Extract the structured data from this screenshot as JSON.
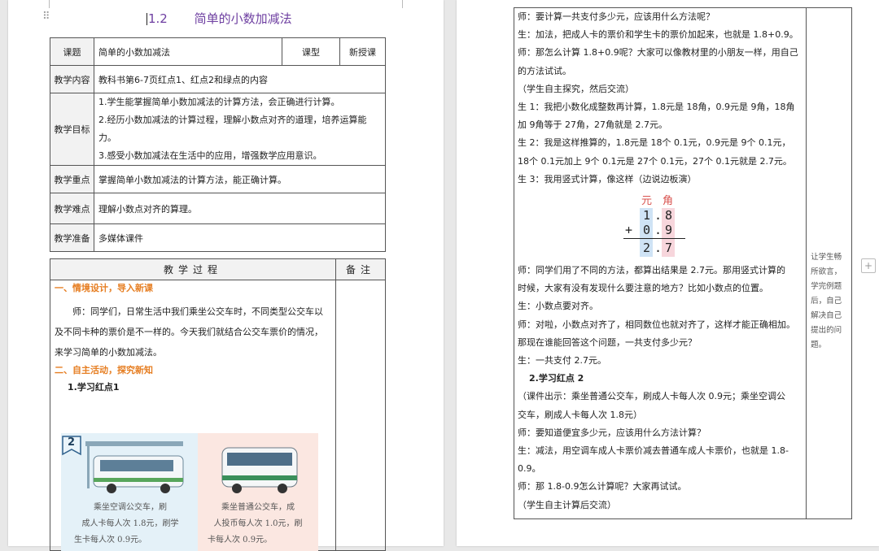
{
  "left": {
    "title_prefix": "1.2",
    "title_text": "简单的小数加减法",
    "info": {
      "r1": {
        "label": "课题",
        "value": "简单的小数加减法",
        "type_label": "课型",
        "type_value": "新授课"
      },
      "r2": {
        "label": "教学内容",
        "value": "教科书第6-7页红点1、红点2和绿点的内容"
      },
      "r3": {
        "label": "教学目标",
        "goals": [
          "1.学生能掌握简单小数加减法的计算方法，会正确进行计算。",
          "2.经历小数加减法的计算过程，理解小数点对齐的道理，培养运算能力。",
          "3.感受小数加减法在生活中的应用，增强数学应用意识。"
        ]
      },
      "r4": {
        "label": "教学重点",
        "value": "掌握简单小数加减法的计算方法，能正确计算。"
      },
      "r5": {
        "label": "教学难点",
        "value": "理解小数点对齐的算理。"
      },
      "r6": {
        "label": "教学准备",
        "value": "多媒体课件"
      }
    },
    "process": {
      "head_main": "教学过程",
      "head_note": "备注",
      "section1": "一、情境设计，导入新课",
      "para1_l1": "师：同学们，日常生活中我们乘坐公交车时，不同类型公交车以",
      "para1_l2": "及不同卡种的票价是不一样的。今天我们就结合公交车票价的情况，",
      "para1_l3": "来学习简单的小数加减法。",
      "section2": "二、自主活动，探究新知",
      "sub1": "1.学习红点1",
      "badge": "2",
      "cap_left": [
        "乘坐空调公交车，刷",
        "成人卡每人次 1.8元，刷学",
        "生卡每人次 0.9元。"
      ],
      "cap_right": [
        "乘坐普通公交车，成",
        "人投币每人次 1.0元，刷",
        "卡每人次 0.9元。"
      ]
    }
  },
  "right": {
    "lines_a": [
      "师：要计算一共支付多少元，应该用什么方法呢？",
      "生：加法，把成人卡的票价和学生卡的票价加起来，也就是 1.8+0.9。",
      "师：那怎么计算 1.8+0.9呢？大家可以像教材里的小朋友一样，用自己",
      "的方法试试。",
      "（学生自主探究，然后交流）",
      "生 1：我把小数化成整数再计算，1.8元是 18角，0.9元是 9角，18角",
      "加 9角等于 27角，27角就是 2.7元。",
      "生 2：我是这样推算的，1.8元是 18个 0.1元，0.9元是 9个 0.1元，",
      "18个 0.1元加上 9个 0.1元是 27个 0.1元，27个 0.1元就是 2.7元。",
      "生 3：我用竖式计算，像这样（边说边板演）"
    ],
    "calc": {
      "yuan": "元",
      "jiao": "角",
      "r1a": "1",
      "r1b": "8",
      "plus": "+",
      "r2a": "0",
      "r2b": "9",
      "r3a": "2",
      "r3b": "7",
      "dot": "."
    },
    "lines_b": [
      "师：同学们用了不同的方法，都算出结果是 2.7元。那用竖式计算的",
      "时候，大家有没有发现什么要注意的地方？比如小数点的位置。",
      "生：小数点要对齐。",
      "师：对啦，小数点对齐了，相同数位也就对齐了，这样才能正确相加。",
      "那现在谁能回答这个问题，一共支付多少元？",
      "生：一共支付 2.7元。"
    ],
    "sub2": "2.学习红点 2",
    "lines_c": [
      "（课件出示：乘坐普通公交车，刷成人卡每人次 0.9元；乘坐空调公",
      "交车，刷成人卡每人次 1.8元）",
      "师：要知道便宜多少元，应该用什么方法计算？",
      "生：减法，用空调车成人卡票价减去普通车成人卡票价，也就是 1.8-",
      "0.9。",
      "师：那 1.8-0.9怎么计算呢？大家再试试。",
      "（学生自主计算后交流）"
    ],
    "note": [
      "让学生畅",
      "所欲言，",
      "学完例题",
      "后，自己",
      "解决自己",
      "提出的问",
      "题。"
    ],
    "plus_icon": "+"
  },
  "colors": {
    "title": "#6e3fa1",
    "section": "#e67e22",
    "calc_yuan": "#d9534f",
    "calc_blue": "#cfe3f5",
    "calc_pink": "#f7d6dc"
  }
}
